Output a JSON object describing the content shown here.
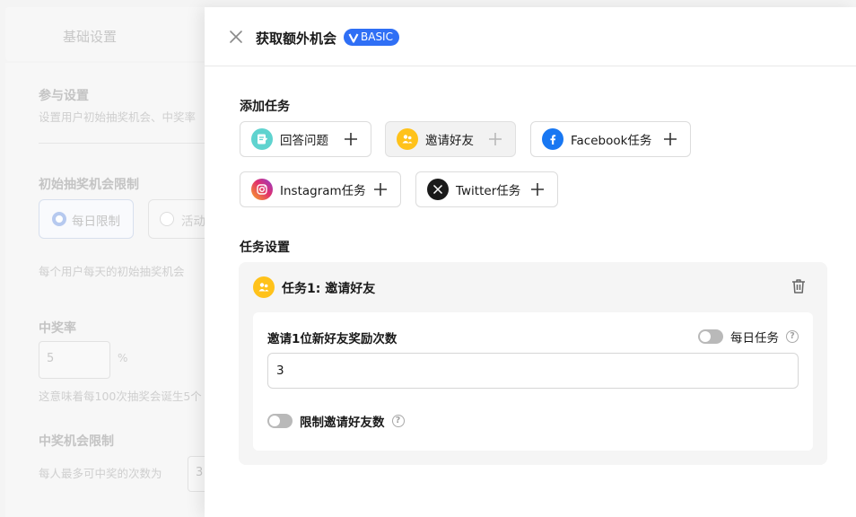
{
  "background": {
    "tab_label": "基础设置",
    "participation_title": "参与设置",
    "participation_desc": "设置用户初始抽奖机会、中奖率",
    "initial_limit_title": "初始抽奖机会限制",
    "radio_daily": "每日限制",
    "radio_activity": "活动",
    "initial_desc": "每个用户每天的初始抽奖机会",
    "win_rate_title": "中奖率",
    "win_rate_value": "5",
    "win_rate_unit": "%",
    "win_rate_desc": "这意味着每100次抽奖会诞生5个",
    "win_limit_title": "中奖机会限制",
    "win_limit_desc": "每人最多可中奖的次数为",
    "win_limit_value": "3"
  },
  "drawer": {
    "title": "获取额外机会",
    "badge": "BASIC",
    "add_tasks_label": "添加任务",
    "tasks": [
      {
        "label": "回答问题",
        "icon": "question-icon",
        "color": "#5fd3cf"
      },
      {
        "label": "邀请好友",
        "icon": "invite-friend-icon",
        "color": "#ffc21a"
      },
      {
        "label": "Facebook任务",
        "icon": "facebook-icon",
        "color": "#1877f2"
      },
      {
        "label": "Instagram任务",
        "icon": "instagram-icon",
        "color": "#e1306c"
      },
      {
        "label": "Twitter任务",
        "icon": "twitter-x-icon",
        "color": "#1a1a1a"
      }
    ],
    "task_settings_label": "任务设置",
    "task_panel": {
      "title": "任务1: 邀请好友",
      "reward_label": "邀请1位新好友奖励次数",
      "daily_task_label": "每日任务",
      "reward_value": "3",
      "limit_label": "限制邀请好友数",
      "help_glyph": "?"
    }
  }
}
